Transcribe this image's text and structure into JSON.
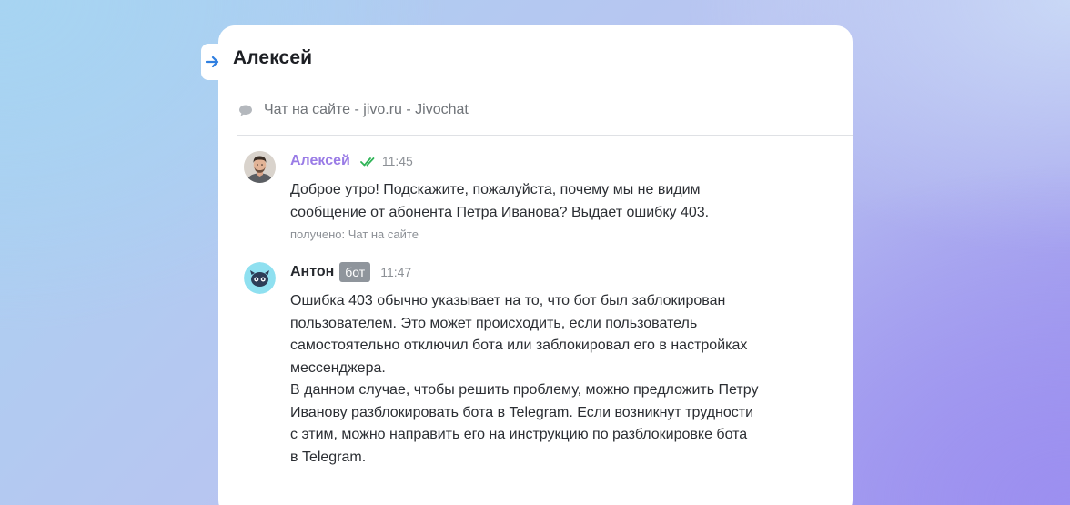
{
  "header": {
    "contact_name": "Алексей"
  },
  "channel": {
    "label": "Чат на сайте - jivo.ru - Jivochat"
  },
  "messages": [
    {
      "author": "Алексей",
      "time": "11:45",
      "text": "Доброе утро! Подскажите, пожалуйста, почему мы не видим\nсообщение от абонента Петра Иванова? Выдает ошибку 403.",
      "received": "получено: Чат на сайте"
    },
    {
      "author": "Антон",
      "badge": "бот",
      "time": "11:47",
      "text": "Ошибка 403 обычно указывает на то, что бот был заблокирован\nпользователем. Это может происходить, если пользователь\nсамостоятельно отключил бота или заблокировал его в настройках\nмессенджера.\nВ данном случае, чтобы решить проблему, можно предложить Петру\nИванову разблокировать бота в Telegram. Если возникнут трудности\nс этим, можно направить его на инструкцию по разблокировке бота\nв Telegram."
    }
  ],
  "icons": {
    "incoming": "arrow-right-icon",
    "channel": "chat-bubble-icon",
    "read_status": "double-check-icon",
    "client_avatar": "user-avatar",
    "bot_avatar": "bot-avatar"
  },
  "colors": {
    "accent_blue": "#2f7fe0",
    "client_name": "#9a7ce6",
    "check_green": "#2fb457",
    "bot_badge": "#8f959c",
    "bot_avatar_bg": "#8fe0f0"
  }
}
